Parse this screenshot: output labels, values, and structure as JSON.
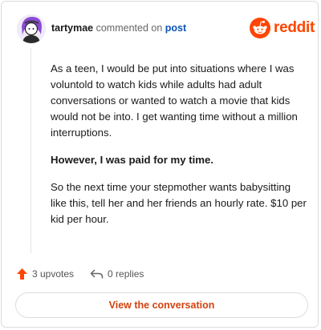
{
  "header": {
    "username": "tartymae",
    "action_text": "commented on",
    "target": "post"
  },
  "brand": {
    "icon": "reddit-logo-icon",
    "wordmark": "reddit",
    "color": "#ff4500"
  },
  "comment": {
    "paragraphs": [
      "As a teen, I would be put into situations where I was voluntold to watch kids while adults had adult conversations or wanted to watch a movie that kids would not be into. I get wanting time without a million interruptions.",
      "However, I was paid for my time.",
      "So the next time your stepmother wants babysitting like this, tell her and her friends an hourly rate. $10 per kid per hour."
    ]
  },
  "actions": {
    "upvotes_icon": "upvote-arrow-icon",
    "upvotes": "3 upvotes",
    "replies_icon": "reply-arrow-icon",
    "replies": "0 replies"
  },
  "cta": {
    "label": "View the conversation"
  }
}
